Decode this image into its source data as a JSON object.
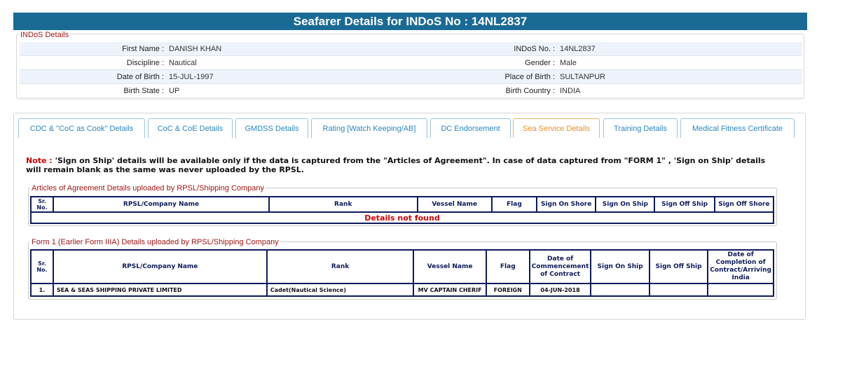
{
  "header": {
    "title": "Seafarer Details for INDoS No : 14NL2837"
  },
  "indos": {
    "legend": "INDoS Details",
    "rows": [
      {
        "l1": "First Name",
        "v1": "DANISH KHAN",
        "l2": "INDoS No.",
        "v2": "14NL2837"
      },
      {
        "l1": "Discipline",
        "v1": "Nautical",
        "l2": "Gender",
        "v2": "Male"
      },
      {
        "l1": "Date of Birth",
        "v1": "15-JUL-1997",
        "l2": "Place of Birth",
        "v2": "SULTANPUR"
      },
      {
        "l1": "Birth State",
        "v1": "UP",
        "l2": "Birth Country",
        "v2": "INDIA"
      }
    ]
  },
  "tabs": [
    {
      "label": "CDC & \"CoC as Cook\" Details"
    },
    {
      "label": "CoC & CoE Details"
    },
    {
      "label": "GMDSS Details"
    },
    {
      "label": "Rating [Watch Keeping/AB]"
    },
    {
      "label": "DC Endorsement"
    },
    {
      "label": "Sea Service Details",
      "active": true
    },
    {
      "label": "Training Details"
    },
    {
      "label": "Medical Fitness Certificate"
    }
  ],
  "note": {
    "label": "Note :",
    "text": "'Sign on Ship' details will be available only if the data is captured from the \"Articles of Agreement\". In case of data captured from \"FORM 1\" , 'Sign on Ship' details will remain blank as the same was never uploaded by the RPSL."
  },
  "articles": {
    "legend": "Articles of Agreement Details uploaded by RPSL/Shipping Company",
    "columns": [
      "Sr. No.",
      "RPSL/Company Name",
      "Rank",
      "Vessel Name",
      "Flag",
      "Sign On Shore",
      "Sign On Ship",
      "Sign Off Ship",
      "Sign Off Shore"
    ],
    "empty_message": "Details not found"
  },
  "form1": {
    "legend": "Form 1 (Earlier Form IIIA) Details uploaded by RPSL/Shipping Company",
    "columns": [
      "Sr. No.",
      "RPSL/Company Name",
      "Rank",
      "Vessel Name",
      "Flag",
      "Date of Commencement of Contract",
      "Sign On Ship",
      "Sign Off Ship",
      "Date of Completion of Contract/Arriving India"
    ],
    "rows": [
      [
        "1.",
        "SEA & SEAS SHIPPING PRIVATE LIMITED",
        "Cadet(Nautical Science)",
        "MV CAPTAIN CHERIF",
        "FOREIGN",
        "04-JUN-2018",
        "",
        "",
        ""
      ]
    ]
  }
}
